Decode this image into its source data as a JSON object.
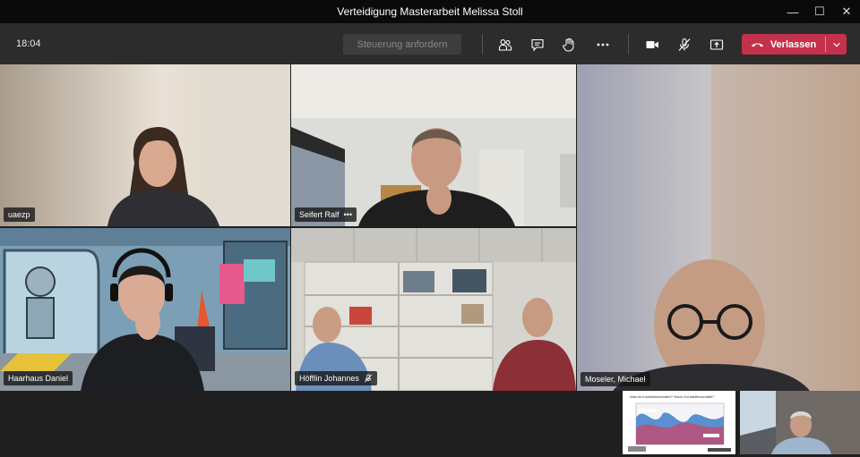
{
  "window": {
    "title": "Verteidigung Masterarbeit Melissa Stoll",
    "minimize_glyph": "—",
    "maximize_glyph": "☐",
    "close_glyph": "✕"
  },
  "toolbar": {
    "clock": "18:04",
    "request_control_label": "Steuerung anfordern",
    "leave_label": "Verlassen",
    "icons": [
      "people-icon",
      "chat-icon",
      "raise-hand-icon",
      "more-options-icon",
      "camera-icon",
      "microphone-muted-icon",
      "share-screen-icon",
      "phone-hangup-icon",
      "chevron-down-icon"
    ]
  },
  "participants": [
    {
      "name": "uaezp"
    },
    {
      "name": "Seifert Ralf",
      "more": "•••"
    },
    {
      "name": "Haarhaus Daniel"
    },
    {
      "name": "Höfflin Johannes",
      "muted": true
    },
    {
      "name": "Moseler, Michael"
    }
  ],
  "shared_content": {
    "title": "Was ist Kontaktbeschaltet? Wozu Kontaktbeschaltet?"
  },
  "colors": {
    "leave_red": "#c4314b",
    "titlebar": "#0a0a0a",
    "toolbar": "#2d2c2c",
    "background": "#1f1f1f"
  }
}
